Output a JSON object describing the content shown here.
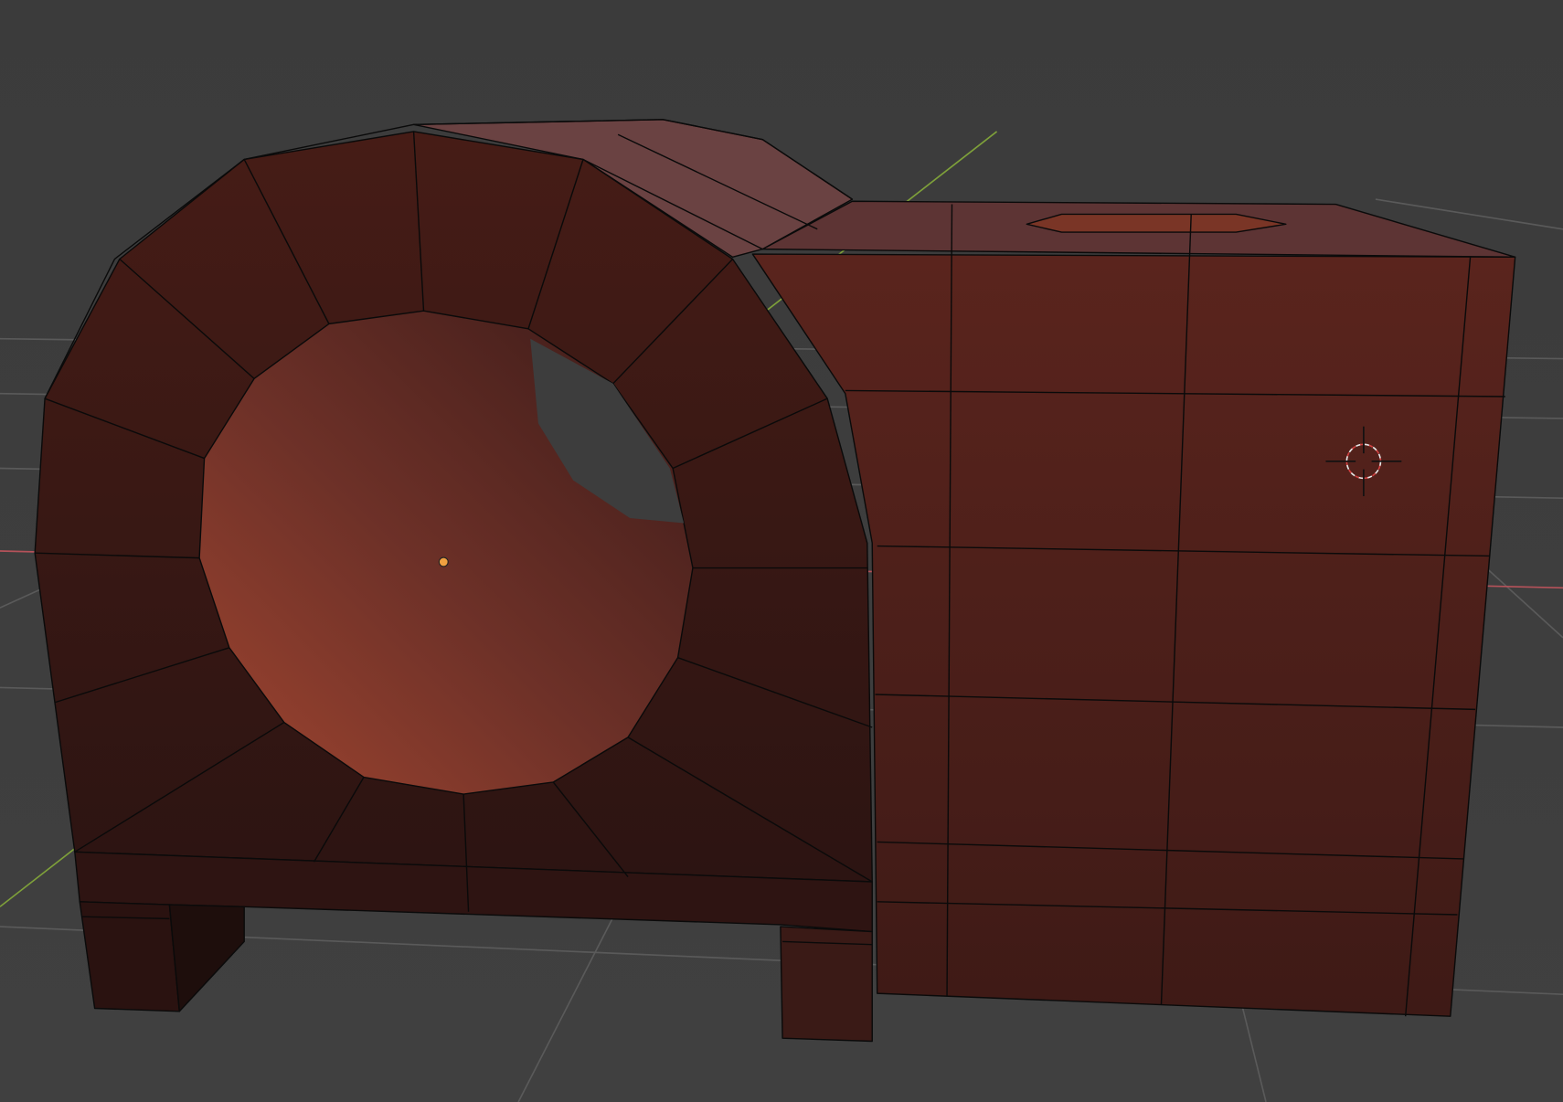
{
  "viewport": {
    "background_color": "#3d3d3d",
    "grid_color": "#555555",
    "x_axis_color": "#b5525a",
    "y_axis_color": "#7ea03a",
    "object_color": "#4a1d18",
    "object_highlight_color": "#8a3a2a",
    "wire_color": "#0a0a0a",
    "origin_color": "#f0a040"
  },
  "icons": {
    "cursor": "3d-cursor-icon",
    "origin": "object-origin-icon"
  }
}
